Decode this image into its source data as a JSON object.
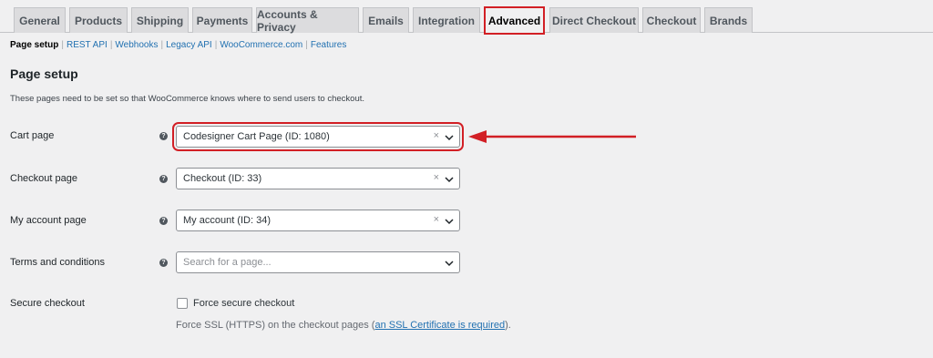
{
  "tabs": [
    "General",
    "Products",
    "Shipping",
    "Payments",
    "Accounts & Privacy",
    "Emails",
    "Integration",
    "Advanced",
    "Direct Checkout",
    "Checkout",
    "Brands"
  ],
  "subnav": {
    "current": "Page setup",
    "links": [
      "REST API",
      "Webhooks",
      "Legacy API",
      "WooCommerce.com",
      "Features"
    ]
  },
  "section_title": "Page setup",
  "section_desc": "These pages need to be set so that WooCommerce knows where to send users to checkout.",
  "rows": {
    "cart": {
      "label": "Cart page",
      "value": "Codesigner Cart Page (ID: 1080)"
    },
    "checkout": {
      "label": "Checkout page",
      "value": "Checkout (ID: 33)"
    },
    "account": {
      "label": "My account page",
      "value": "My account (ID: 34)"
    },
    "terms": {
      "label": "Terms and conditions",
      "placeholder": "Search for a page..."
    },
    "secure": {
      "label": "Secure checkout",
      "checkbox_label": "Force secure checkout",
      "desc_prefix": "Force SSL (HTTPS) on the checkout pages (",
      "desc_link": "an SSL Certificate is required",
      "desc_suffix": ")."
    }
  },
  "glyphs": {
    "help": "?",
    "clear": "×"
  },
  "colors": {
    "highlight": "#d21f25",
    "link": "#2271b1",
    "background": "#f0f0f1"
  }
}
